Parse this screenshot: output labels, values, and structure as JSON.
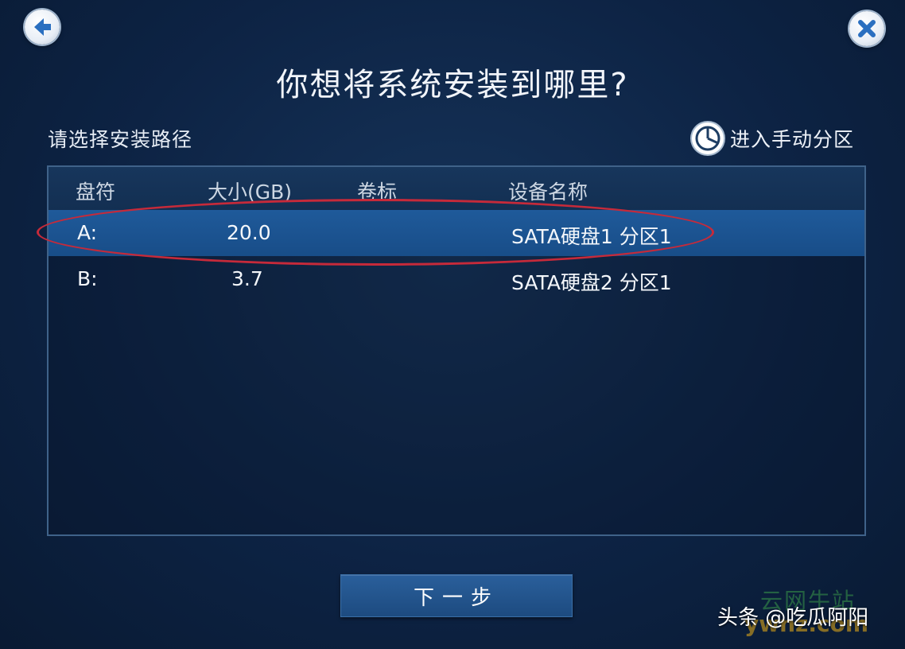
{
  "header": {
    "title": "你想将系统安装到哪里?",
    "back_icon": "back-arrow-icon",
    "close_icon": "close-icon"
  },
  "install_path": {
    "label": "请选择安装路径",
    "manual_partition_label": "进入手动分区",
    "manual_partition_icon": "pie-chart-icon"
  },
  "table": {
    "columns": [
      "盘符",
      "大小(GB)",
      "卷标",
      "设备名称"
    ],
    "rows": [
      {
        "drive": "A:",
        "size": "20.0",
        "label": "",
        "device": "SATA硬盘1 分区1",
        "selected": true
      },
      {
        "drive": "B:",
        "size": "3.7",
        "label": "",
        "device": "SATA硬盘2 分区1",
        "selected": false
      }
    ]
  },
  "footer": {
    "next_label": "下一步"
  },
  "watermarks": {
    "site_cn": "云网牛站",
    "site_url": "ywnz.com",
    "author": "头条 @吃瓜阿阳"
  },
  "colors": {
    "background": "#0d2344",
    "selected_row": "#1f5a9a",
    "highlight_circle": "#c62a3a",
    "button": "#2a5f9b"
  }
}
